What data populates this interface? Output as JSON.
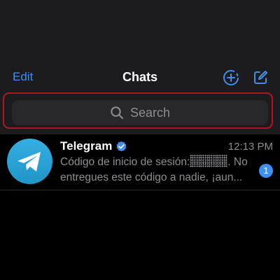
{
  "header": {
    "edit_label": "Edit",
    "title": "Chats",
    "new_channel_icon": "circle-plus-icon",
    "compose_icon": "compose-icon"
  },
  "search": {
    "placeholder": "Search",
    "icon": "search-icon"
  },
  "chats": [
    {
      "name": "Telegram",
      "verified": true,
      "time": "12:13 PM",
      "preview_line1_before": "Código de inicio de sesión:",
      "preview_line1_after": ". No",
      "preview_line2": "entregues este código a nadie, ¡aun...",
      "unread": "1",
      "avatar_icon": "telegram-paper-plane-icon"
    }
  ],
  "colors": {
    "accent": "#3e8ff4",
    "highlight": "#b4141f",
    "header_bg": "#1c1c1e",
    "background": "#000000"
  }
}
